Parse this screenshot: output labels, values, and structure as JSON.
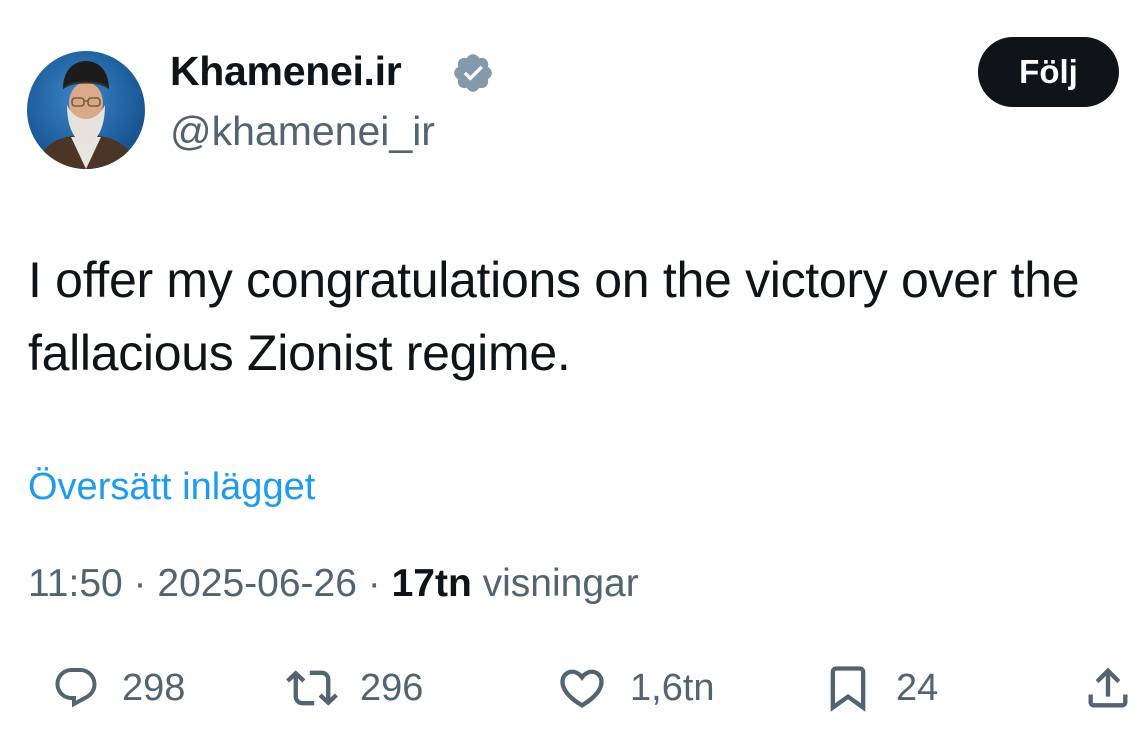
{
  "author": {
    "display_name": "Khamenei.ir",
    "handle": "@khamenei_ir",
    "verified": true,
    "verified_badge_color": "#829aab"
  },
  "follow_button": {
    "label": "Följ"
  },
  "tweet": {
    "text": "I offer my congratulations on the victory over the fallacious Zionist regime."
  },
  "translate": {
    "label": "Översätt inlägget",
    "color": "#1d9bf0"
  },
  "meta": {
    "time": "11:50",
    "separator": "·",
    "date": "2025-06-26",
    "views_count": "17tn",
    "views_label": " visningar"
  },
  "actions": {
    "reply": {
      "icon": "speech-bubble-icon",
      "count": "298"
    },
    "retweet": {
      "icon": "retweet-arrows-icon",
      "count": "296"
    },
    "like": {
      "icon": "heart-icon",
      "count": "1,6tn"
    },
    "bookmark": {
      "icon": "bookmark-icon",
      "count": "24"
    },
    "share": {
      "icon": "share-upload-icon"
    }
  },
  "colors": {
    "text_primary": "#0f1419",
    "text_secondary": "#536471",
    "follow_bg": "#0f1419",
    "link": "#1d9bf0"
  }
}
